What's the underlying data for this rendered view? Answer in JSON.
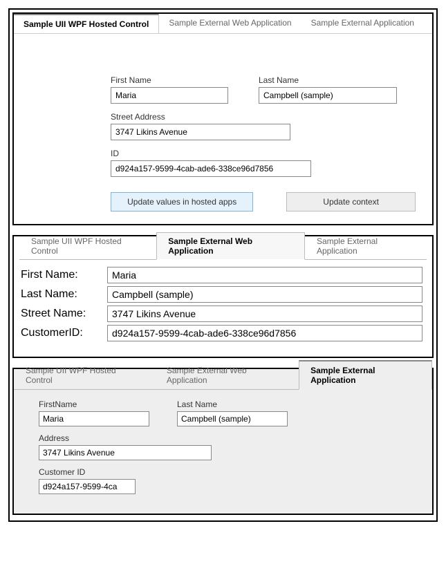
{
  "tabs": {
    "wpf": "Sample UII WPF Hosted Control",
    "webapp": "Sample External Web Application",
    "extapp": "Sample External Application"
  },
  "panel1": {
    "first_name_label": "First Name",
    "last_name_label": "Last Name",
    "street_label": "Street Address",
    "id_label": "ID",
    "first_name": "Maria",
    "last_name": "Campbell (sample)",
    "street": "3747 Likins Avenue",
    "id": "d924a157-9599-4cab-ade6-338ce96d7856",
    "btn_update_apps": "Update values in hosted apps",
    "btn_update_context": "Update context"
  },
  "panel2": {
    "first_name_label": "First Name:",
    "last_name_label": "Last Name:",
    "street_label": "Street Name:",
    "customerid_label": "CustomerID:",
    "first_name": "Maria",
    "last_name": "Campbell (sample)",
    "street": "3747 Likins Avenue",
    "customerid": "d924a157-9599-4cab-ade6-338ce96d7856"
  },
  "panel3": {
    "first_name_label": "FirstName",
    "last_name_label": "Last Name",
    "address_label": "Address",
    "customer_id_label": "Customer ID",
    "first_name": "Maria",
    "last_name": "Campbell (sample)",
    "address": "3747 Likins Avenue",
    "customer_id": "d924a157-9599-4ca"
  }
}
